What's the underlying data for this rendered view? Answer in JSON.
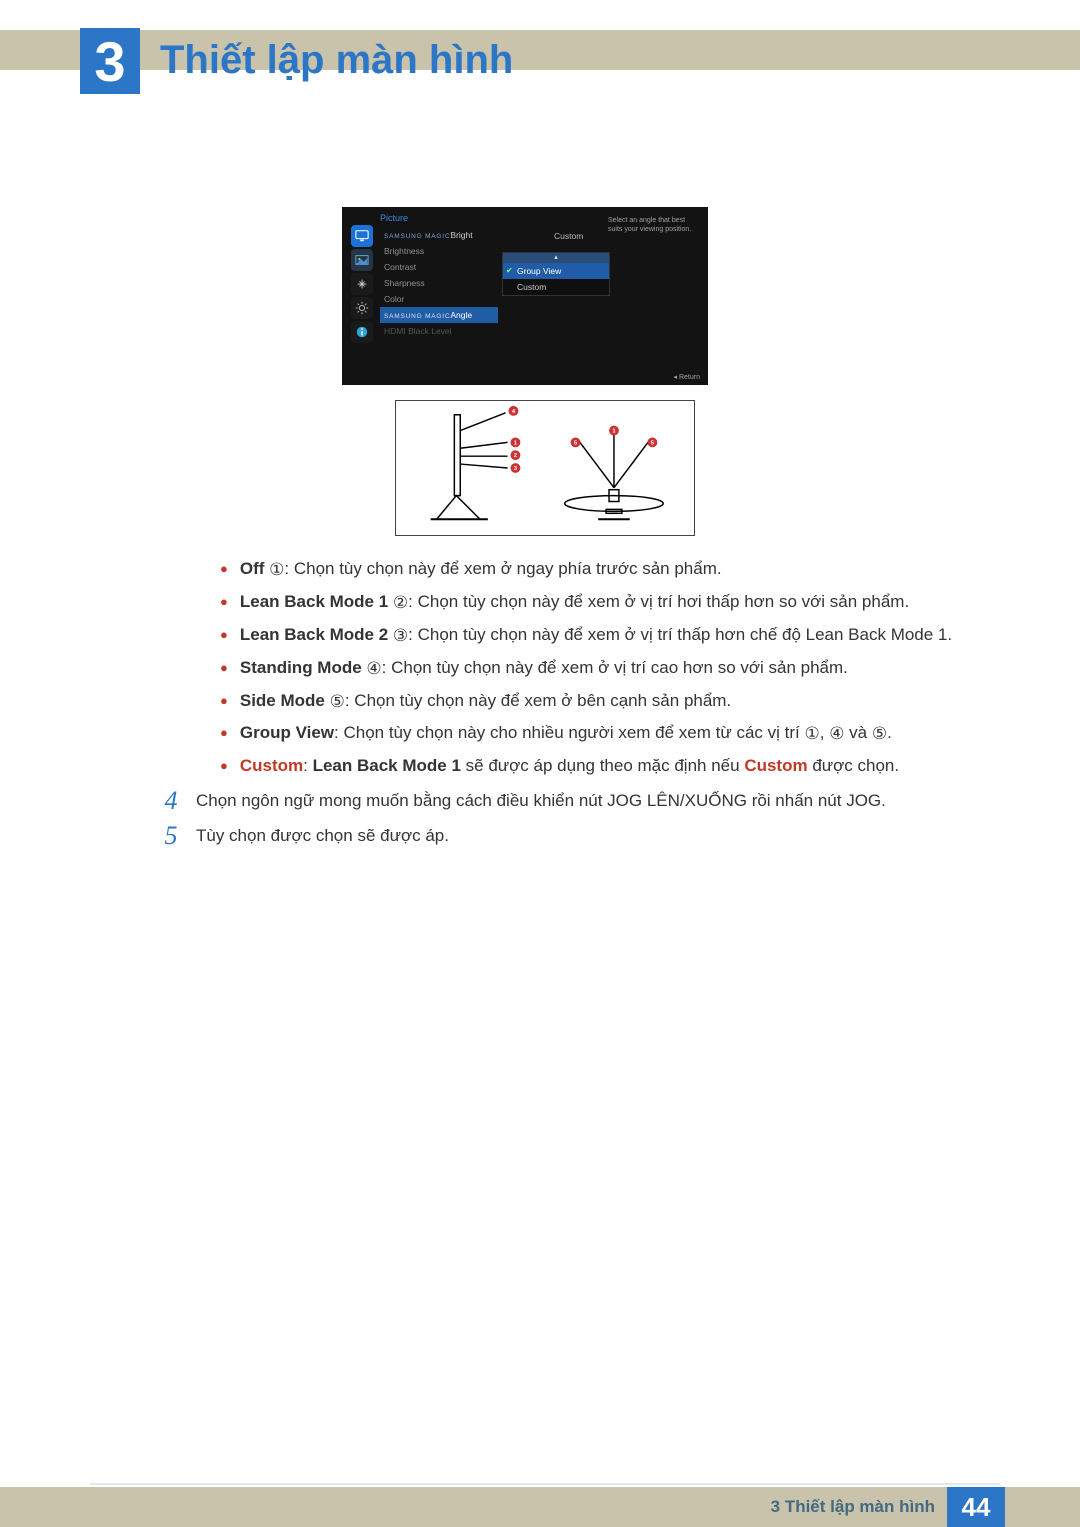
{
  "chapter": {
    "number": "3",
    "title": "Thiết lập màn hình"
  },
  "osd": {
    "panel_title": "Picture",
    "menu": {
      "items": [
        {
          "magic": "SAMSUNG MAGIC",
          "suffix": "Bright"
        },
        {
          "label": "Brightness"
        },
        {
          "label": "Contrast"
        },
        {
          "label": "Sharpness"
        },
        {
          "label": "Color"
        },
        {
          "magic": "SAMSUNG MAGIC",
          "suffix": "Angle",
          "selected": true
        },
        {
          "label": "HDMI Black Level",
          "dim": true
        }
      ],
      "value_right_of_first": "Custom"
    },
    "popup": {
      "options": [
        {
          "label": "Group View",
          "selected": true
        },
        {
          "label": "Custom"
        }
      ]
    },
    "help": "Select an angle that best suits your viewing position.",
    "return": "Return"
  },
  "diagram_points": [
    "1",
    "2",
    "3",
    "4",
    "5",
    "1",
    "5"
  ],
  "bullets": [
    {
      "bold": "Off",
      "circ": "①",
      "rest": ": Chọn tùy chọn này để xem ở ngay phía trước sản phẩm."
    },
    {
      "bold": "Lean Back Mode 1",
      "circ": "②",
      "rest": ": Chọn tùy chọn này để xem ở vị trí hơi thấp hơn so với sản phẩm."
    },
    {
      "bold": "Lean Back Mode 2",
      "circ": "③",
      "rest": ": Chọn tùy chọn này để xem ở vị trí thấp hơn chế độ Lean Back Mode 1."
    },
    {
      "bold": "Standing Mode",
      "circ": "④",
      "rest": ": Chọn tùy chọn này để xem ở vị trí cao hơn so với sản phẩm."
    },
    {
      "bold": "Side Mode",
      "circ": "⑤",
      "rest": ": Chọn tùy chọn này để xem ở bên cạnh sản phẩm."
    },
    {
      "bold": "Group View",
      "rest_parts": [
        ": Chọn tùy chọn này cho nhiều người xem để xem từ các vị trí ",
        "①",
        ", ",
        "④",
        " và ",
        "⑤",
        "."
      ]
    },
    {
      "custom_line": {
        "p1": "Custom",
        "p2": ": ",
        "p3": "Lean Back Mode 1",
        "p4": " sẽ được áp dụng theo mặc định nếu ",
        "p5": "Custom",
        "p6": " được chọn."
      }
    }
  ],
  "steps": [
    {
      "n": "4",
      "text": "Chọn ngôn ngữ mong muốn bằng cách điều khiển nút JOG LÊN/XUỐNG rồi nhấn nút JOG."
    },
    {
      "n": "5",
      "text": "Tùy chọn được chọn sẽ được áp."
    }
  ],
  "footer": {
    "label": "3 Thiết lập màn hình",
    "page": "44"
  }
}
